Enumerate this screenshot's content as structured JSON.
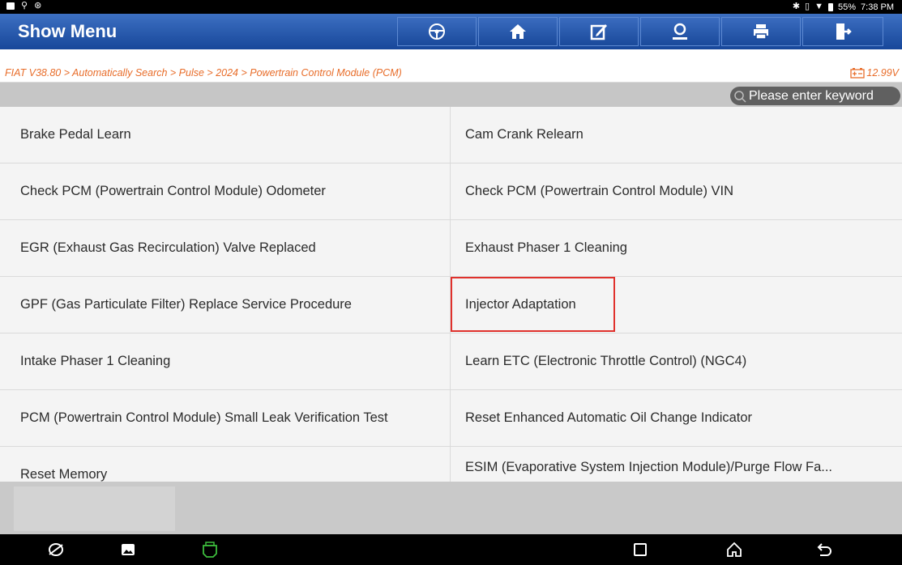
{
  "status_bar": {
    "battery_text": "55%",
    "time": "7:38 PM",
    "left_icons": [
      "gallery-icon",
      "usb-debug-icon",
      "accessibility-icon"
    ],
    "right_icons": [
      "bluetooth-icon",
      "vibrate-icon",
      "wifi-icon",
      "battery-icon"
    ]
  },
  "header": {
    "title": "Show Menu",
    "buttons": [
      {
        "name": "steering-wheel-icon"
      },
      {
        "name": "home-icon"
      },
      {
        "name": "edit-icon"
      },
      {
        "name": "user-icon"
      },
      {
        "name": "print-icon"
      },
      {
        "name": "exit-icon"
      }
    ]
  },
  "breadcrumb": {
    "text": "FIAT V38.80 > Automatically Search > Pulse > 2024 > Powertrain Control Module (PCM)",
    "voltage": "12.99V"
  },
  "search": {
    "placeholder": "Please enter keyword"
  },
  "menu": {
    "rows": [
      [
        "Brake Pedal Learn",
        "Cam Crank Relearn"
      ],
      [
        "Check PCM (Powertrain Control Module) Odometer",
        "Check PCM (Powertrain Control Module) VIN"
      ],
      [
        "EGR (Exhaust Gas Recirculation) Valve Replaced",
        "Exhaust Phaser 1 Cleaning"
      ],
      [
        "GPF (Gas Particulate Filter) Replace Service Procedure",
        "Injector Adaptation"
      ],
      [
        "Intake Phaser 1 Cleaning",
        "Learn ETC (Electronic Throttle Control) (NGC4)"
      ],
      [
        "PCM (Powertrain Control Module) Small Leak Verification Test",
        "Reset Enhanced Automatic Oil Change Indicator"
      ],
      [
        "Reset Memory",
        "ESIM (Evaporative System Injection Module)/Purge Flow Fa..."
      ]
    ],
    "highlighted": "Injector Adaptation"
  },
  "colors": {
    "header": "#2355a8",
    "breadcrumb_text": "#e86d2a",
    "highlight_border": "#e0312c"
  },
  "nav_bar": {
    "icons": [
      "browser-icon",
      "gallery-icon",
      "vci-icon",
      "recents-icon",
      "home-icon",
      "back-icon"
    ]
  }
}
